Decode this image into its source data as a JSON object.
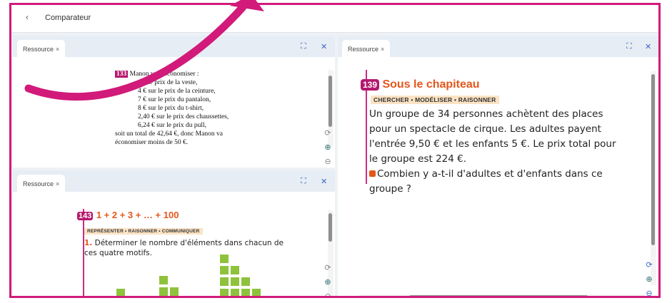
{
  "topbar": {
    "back_icon": "chevron-left",
    "title": "Comparateur"
  },
  "panels": {
    "top_left": {
      "tab_label": "Ressource",
      "close_glyph": "×",
      "exercise_number": "133",
      "text_lines": [
        "Manon veut économiser :",
        "sur le prix de la veste,",
        "4 € sur le prix de la ceinture,",
        "7 € sur le prix du pantalon,",
        "8 € sur le prix du t-shirt,",
        "2,40 € sur le prix des chaussettes,",
        "6,24 € sur le prix du pull,",
        "soit un total de 42,64 €, donc Manon va",
        "économiser moins de 50 €."
      ]
    },
    "bottom_left": {
      "tab_label": "Ressource",
      "close_glyph": "×",
      "exercise_number": "143",
      "title": "1 + 2 + 3 + … + 100",
      "tags": "REPRÉSENTER • RAISONNER • COMMUNIQUER",
      "q_number": "1.",
      "question": "Déterminer le nombre d'éléments dans chacun de ces quatre motifs."
    },
    "right": {
      "tab_label": "Ressource",
      "close_glyph": "×",
      "exercise_number": "139",
      "title": "Sous le chapiteau",
      "tags": "CHERCHER • MODÉLISER • RAISONNER",
      "paragraph_lines": [
        "Un groupe de 34 personnes achètent des places",
        "pour un spectacle de cirque. Les adultes payent",
        "l'entrée 9,50 € et les enfants 5 €. Le prix total pour",
        "le groupe est 224 €."
      ],
      "question_lines": [
        "Combien y a-t-il d'adultes et d'enfants dans ce",
        "groupe ?"
      ]
    }
  },
  "colors": {
    "frame": "#d11a7a",
    "accent": "#b4186e",
    "title_orange": "#e4561b",
    "tag_bg": "#fbe3c4",
    "squares": "#8fc23c",
    "control_blue": "#3a67c4"
  }
}
